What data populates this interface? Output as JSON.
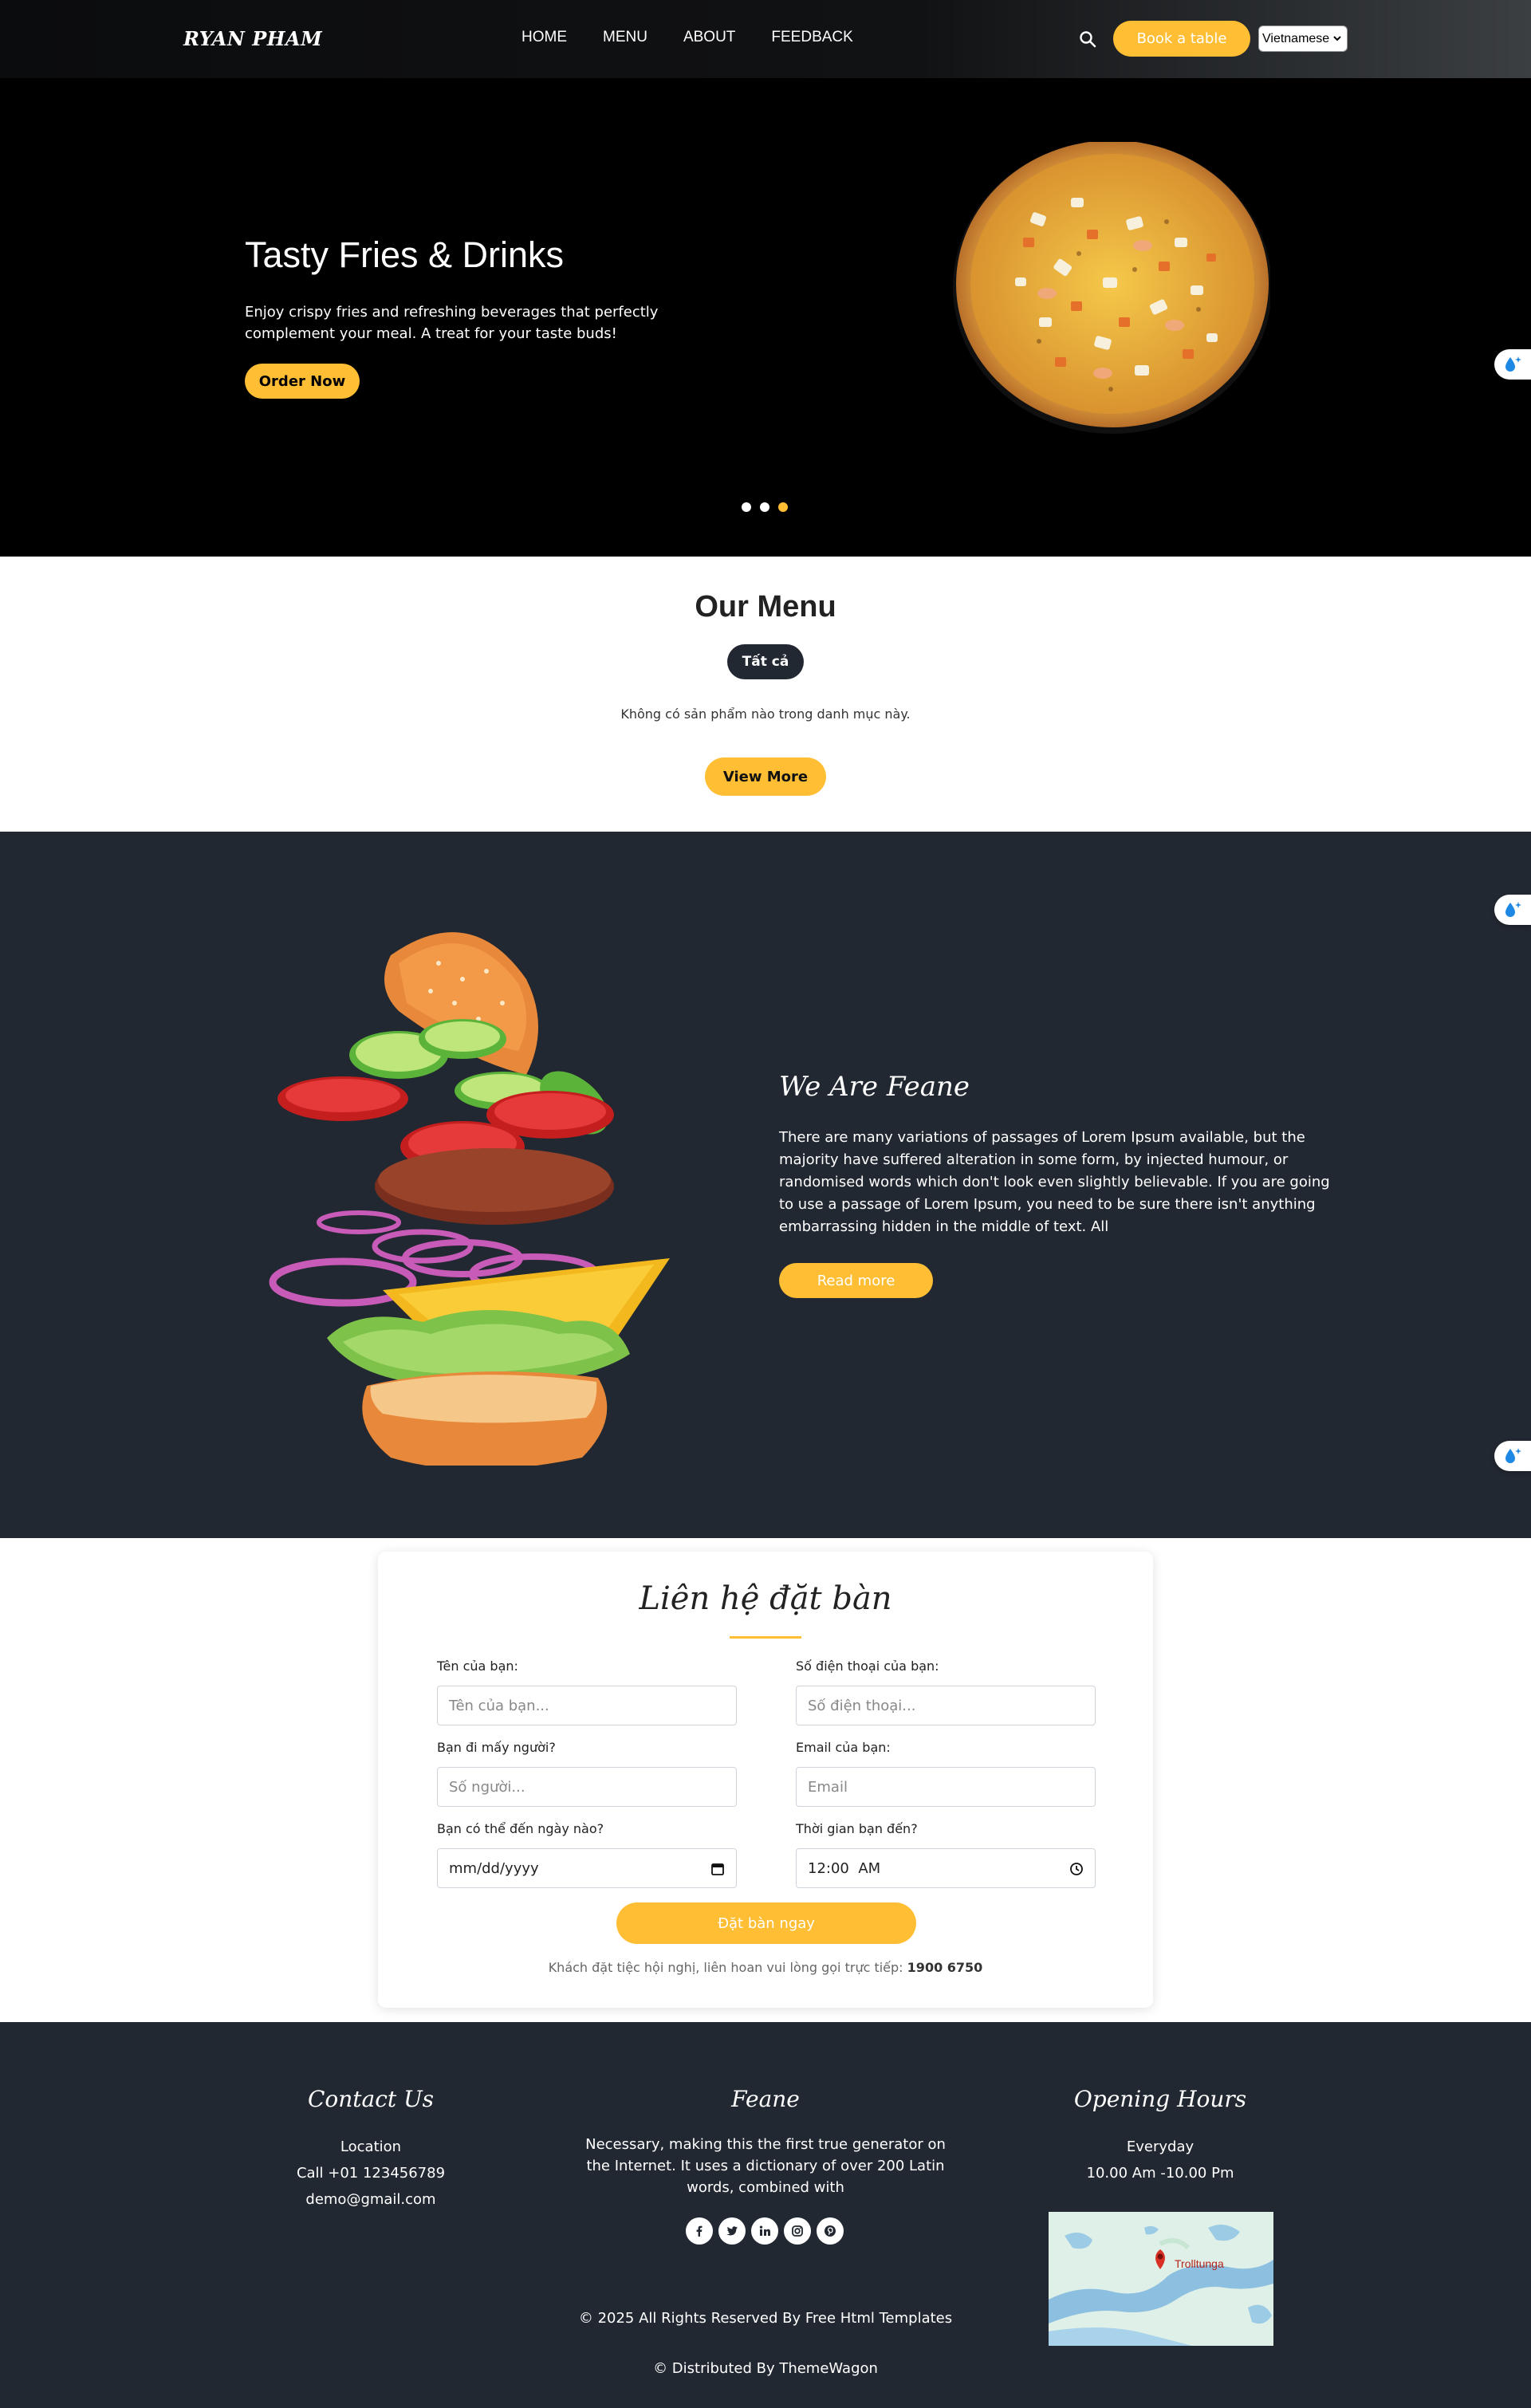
{
  "header": {
    "brand": "RYAN PHAM",
    "nav": [
      "HOME",
      "MENU",
      "ABOUT",
      "FEEDBACK"
    ],
    "book_label": "Book a table",
    "language": "Vietnamese"
  },
  "hero": {
    "title": "Tasty Fries & Drinks",
    "description": "Enjoy crispy fries and refreshing beverages that perfectly complement your meal. A treat for your taste buds!",
    "cta": "Order Now",
    "slides_total": 3,
    "active_slide": 3
  },
  "menu": {
    "title": "Our Menu",
    "filter": "Tất cả",
    "empty_message": "Không có sản phẩm nào trong danh mục này.",
    "view_more": "View More"
  },
  "about": {
    "title": "We Are Feane",
    "text": "There are many variations of passages of Lorem Ipsum available, but the majority have suffered alteration in some form, by injected humour, or randomised words which don't look even slightly believable. If you are going to use a passage of Lorem Ipsum, you need to be sure there isn't anything embarrassing hidden in the middle of text. All",
    "read_more": "Read more"
  },
  "booking": {
    "title": "Liên hệ đặt bàn",
    "name_label": "Tên của bạn:",
    "name_placeholder": "Tên của bạn...",
    "phone_label": "Số điện thoại của bạn:",
    "phone_placeholder": "Số điện thoại...",
    "people_label": "Bạn đi mấy người?",
    "people_placeholder": "Số người...",
    "email_label": "Email của bạn:",
    "email_placeholder": "Email",
    "date_label": "Bạn có thể đến ngày nào?",
    "date_value": "mm/dd/yyyy",
    "time_label": "Thời gian bạn đến?",
    "time_value": "12:00  AM",
    "submit": "Đặt bàn ngay",
    "hotline_text": "Khách đặt tiệc hội nghị, liên hoan vui lòng gọi trực tiếp:",
    "hotline_number": "1900 6750"
  },
  "footer": {
    "contact_title": "Contact Us",
    "location": "Location",
    "phone": "Call +01 123456789",
    "email": "demo@gmail.com",
    "feane_title": "Feane",
    "feane_text": "Necessary, making this the first true generator on the Internet. It uses a dictionary of over 200 Latin words, combined with",
    "hours_title": "Opening Hours",
    "hours_days": "Everyday",
    "hours_time": "10.00 Am -10.00 Pm",
    "map_label": "Trolltunga",
    "copyright": "© 2025 All Rights Reserved By Free Html Templates",
    "distributed": "© Distributed By ThemeWagon",
    "socials": [
      "facebook-icon",
      "twitter-icon",
      "linkedin-icon",
      "instagram-icon",
      "pinterest-icon"
    ]
  },
  "colors": {
    "accent": "#ffbe33",
    "dark": "#222831",
    "black": "#000000"
  }
}
